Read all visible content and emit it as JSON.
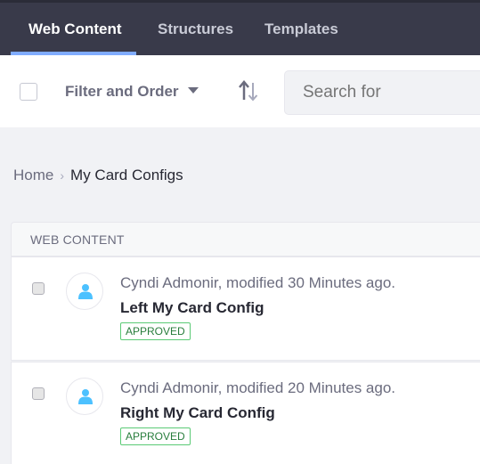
{
  "nav": {
    "tabs": [
      {
        "label": "Web Content",
        "active": true
      },
      {
        "label": "Structures",
        "active": false
      },
      {
        "label": "Templates",
        "active": false
      }
    ]
  },
  "toolbar": {
    "filter_label": "Filter and Order",
    "sort_icon": "sort-arrows-icon",
    "search_placeholder": "Search for"
  },
  "breadcrumb": {
    "home": "Home",
    "separator_icon": "chevron-right-icon",
    "current": "My Card Configs"
  },
  "list": {
    "header": "WEB CONTENT",
    "items": [
      {
        "meta": "Cyndi Admonir, modified 30 Minutes ago.",
        "title": "Left My Card Config",
        "status": "APPROVED"
      },
      {
        "meta": "Cyndi Admonir, modified 20 Minutes ago.",
        "title": "Right My Card Config",
        "status": "APPROVED"
      }
    ]
  },
  "colors": {
    "nav_bg": "#393a4a",
    "accent": "#80acff",
    "approved": "#287d3c",
    "avatar_icon": "#4cc1ff"
  }
}
